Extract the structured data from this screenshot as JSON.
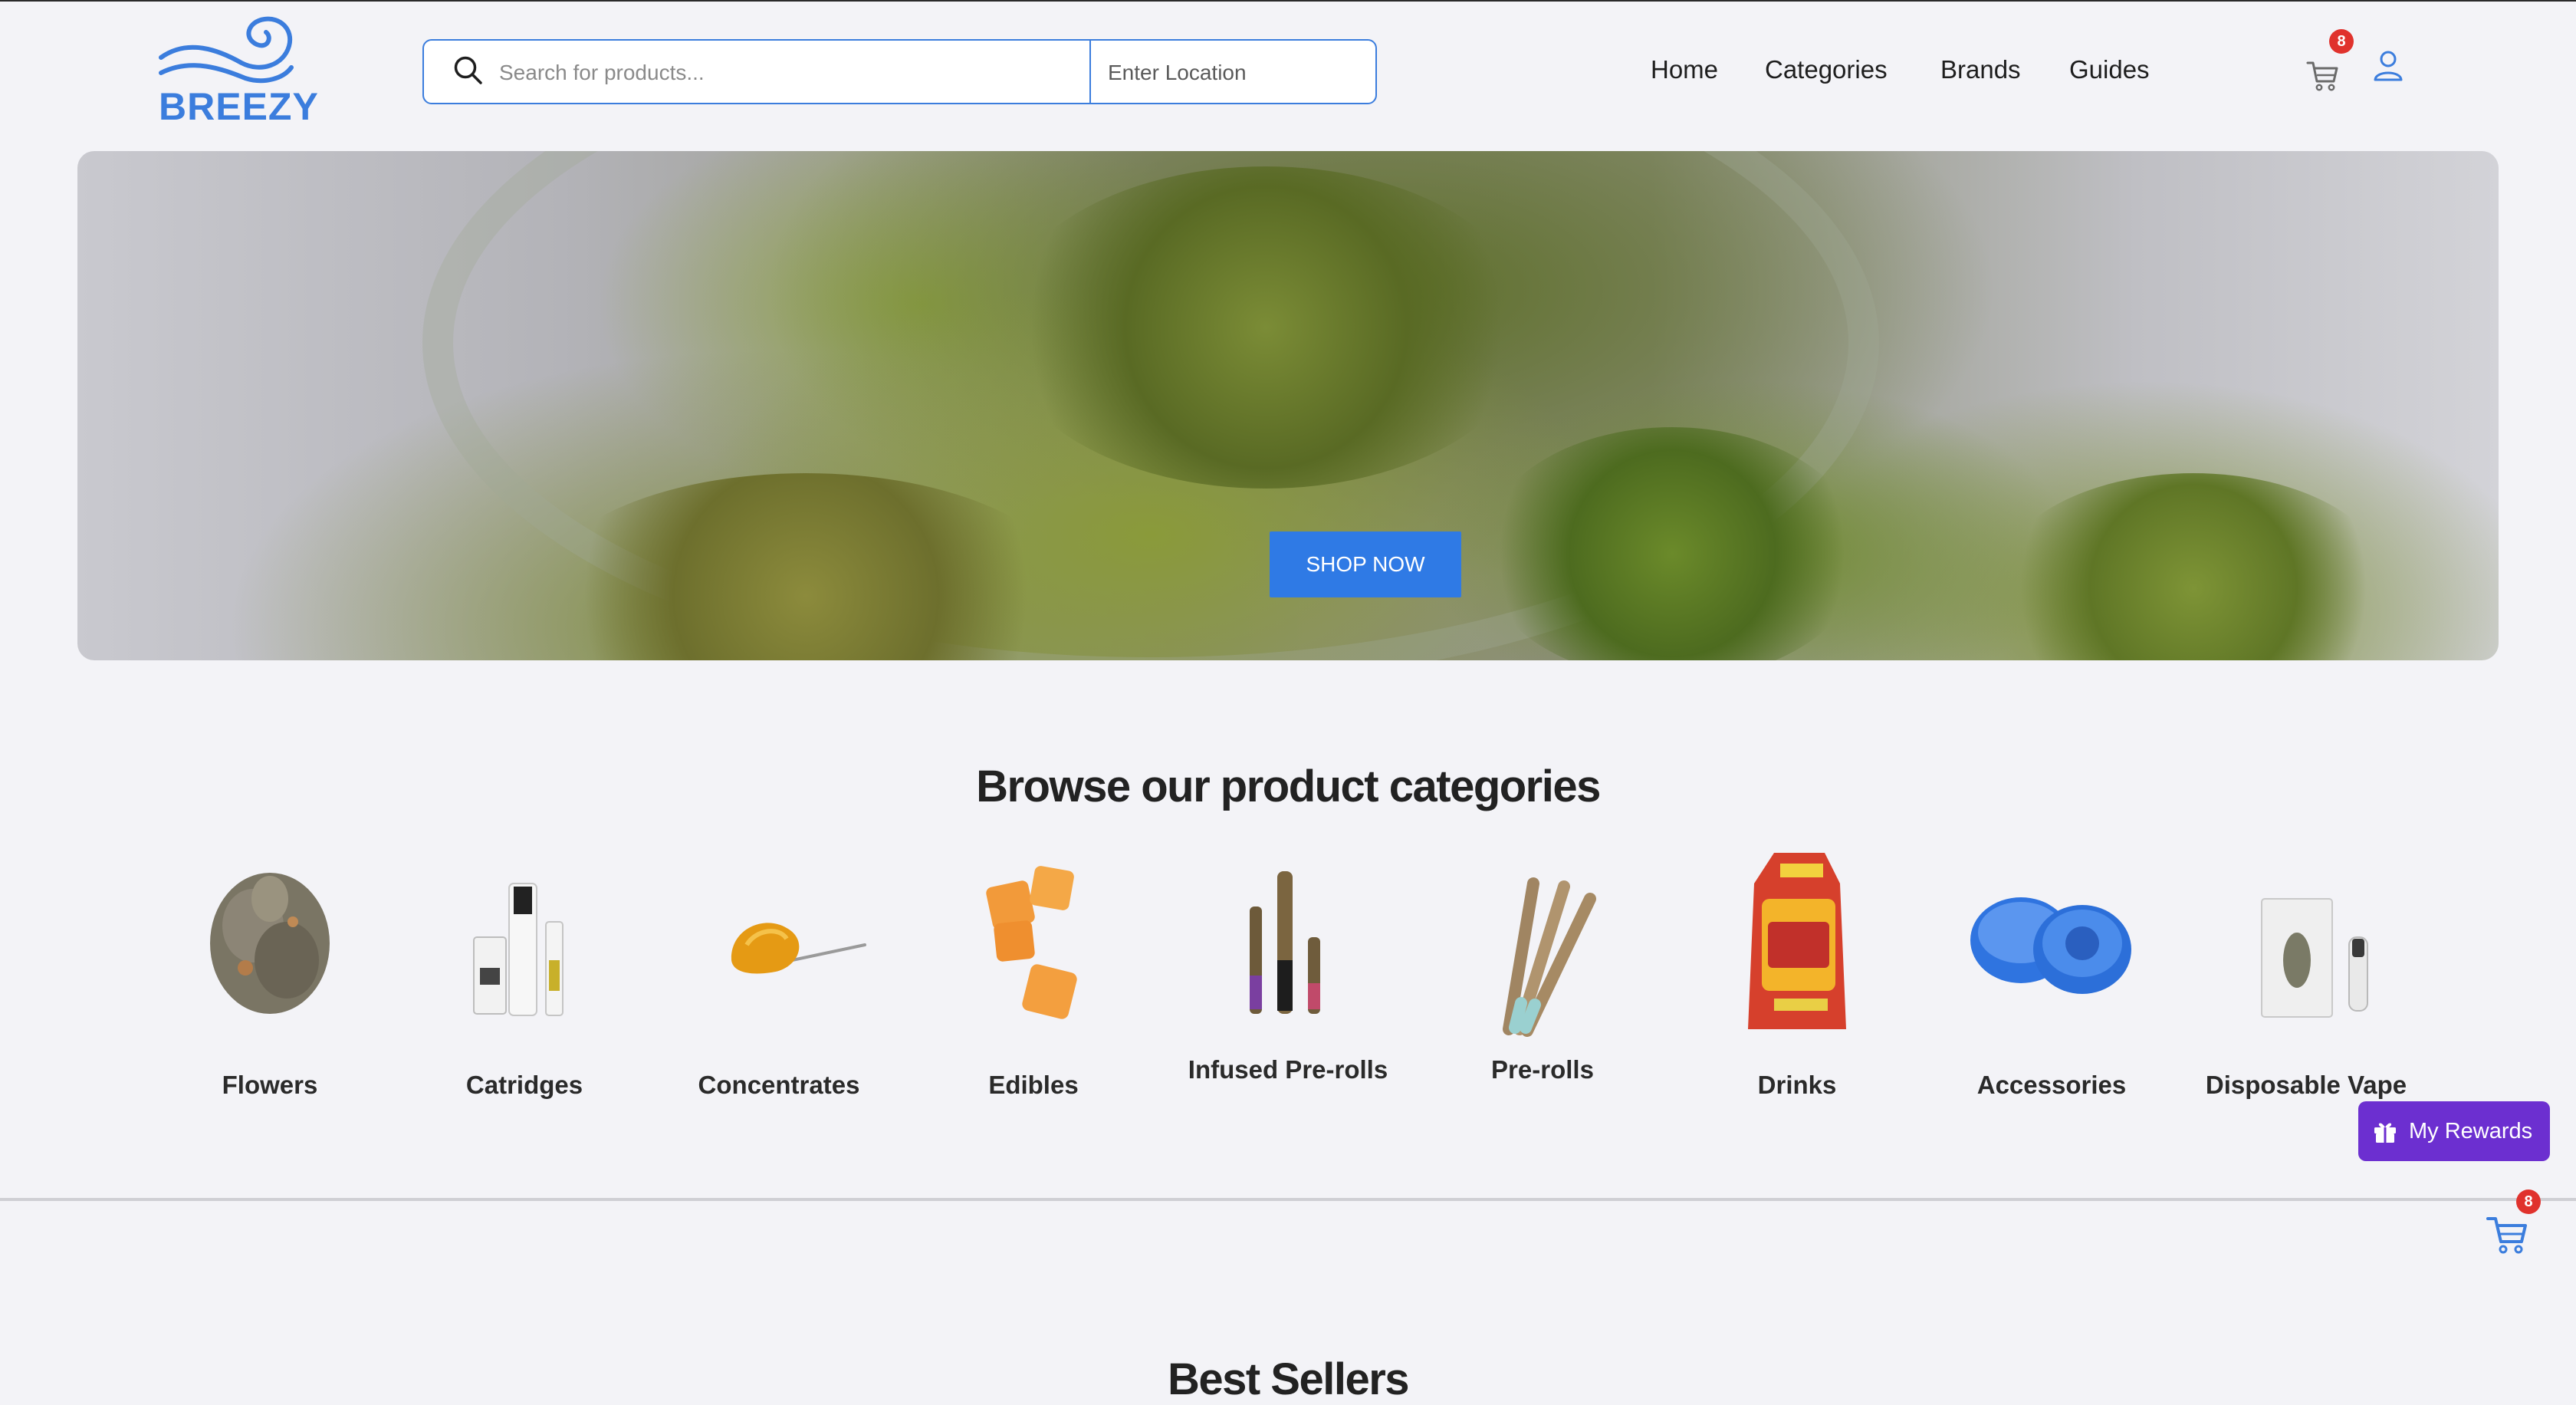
{
  "header": {
    "logo_text": "BREEZY",
    "search_placeholder": "Search for products...",
    "location_placeholder": "Enter Location",
    "nav": [
      "Home",
      "Categories",
      "Brands",
      "Guides"
    ],
    "cart_count": "8",
    "icons": {
      "search": "search-icon",
      "cart": "cart-icon",
      "user": "user-icon"
    }
  },
  "hero": {
    "cta_label": "SHOP NOW"
  },
  "categories": {
    "title": "Browse our product categories",
    "items": [
      {
        "label": "Flowers"
      },
      {
        "label": "Catridges"
      },
      {
        "label": "Concentrates"
      },
      {
        "label": "Edibles"
      },
      {
        "label": "Infused Pre-rolls"
      },
      {
        "label": "Pre-rolls"
      },
      {
        "label": "Drinks"
      },
      {
        "label": "Accessories"
      },
      {
        "label": "Disposable Vape"
      }
    ]
  },
  "rewards": {
    "label": "My Rewards"
  },
  "floating_cart": {
    "count": "8"
  },
  "best_sellers": {
    "title": "Best Sellers"
  },
  "colors": {
    "accent": "#3b7ddd",
    "cta": "#2f7ae5",
    "rewards": "#6c2fd0",
    "badge": "#e0322d",
    "background": "#f3f3f7"
  }
}
